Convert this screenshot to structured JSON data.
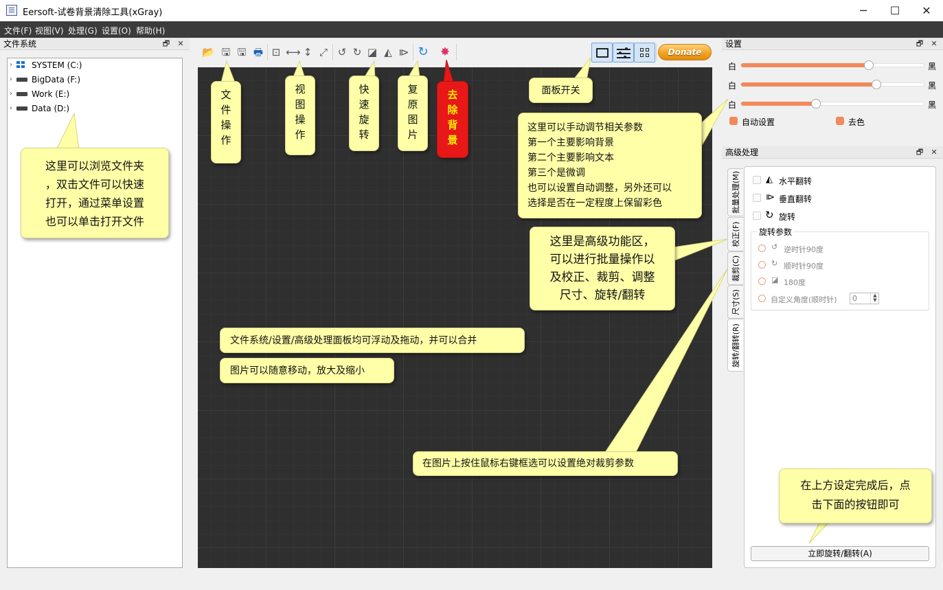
{
  "window": {
    "title": "Eersoft-试卷背景清除工具(xGray)",
    "minimize_glyph": "─",
    "maximize_glyph": "☐",
    "close_glyph": "✕"
  },
  "menu": [
    "文件(F)",
    "视图(V)",
    "处理(G)",
    "设置(O)",
    "帮助(H)"
  ],
  "file_panel": {
    "title": "文件系统",
    "drives": [
      {
        "label": "SYSTEM (C:)",
        "icon": "windows-drive-icon"
      },
      {
        "label": "BigData (F:)",
        "icon": "drive-icon"
      },
      {
        "label": "Work (E:)",
        "icon": "drive-icon"
      },
      {
        "label": "Data (D:)",
        "icon": "drive-icon"
      }
    ]
  },
  "toolbar": {
    "donate_label": "Donate",
    "icons": [
      "open-folder-icon",
      "save-icon",
      "save-as-icon",
      "print-icon",
      "fit-icon",
      "fit-width-icon",
      "fit-height-icon",
      "fullscreen-icon",
      "rotate-left-icon",
      "rotate-right-icon",
      "rotate-180-icon",
      "flip-horizontal-icon",
      "flip-vertical-icon",
      "restore-icon",
      "magic-wand-icon",
      "folder-panel-icon",
      "sliders-panel-icon",
      "grid-panel-icon"
    ]
  },
  "callouts": {
    "file_ops": "文件操作",
    "view_ops": "视图操作",
    "quick_rotate": "快速旋转",
    "restore_image": "复原图片",
    "remove_bg": "去除背景",
    "panel_switch": "面板开关",
    "browse_folder": [
      "这里可以浏览文件夹",
      "，双击文件可以快速",
      "打开，通过菜单设置",
      "也可以单击打开文件"
    ],
    "params": [
      "这里可以手动调节相关参数",
      "第一个主要影响背景",
      "第二个主要影响文本",
      "第三个是微调",
      "也可以设置自动调整，另外还可以",
      "选择是否在一定程度上保留彩色"
    ],
    "advanced": [
      "这里是高级功能区，",
      "可以进行批量操作以",
      "及校正、裁剪、调整",
      "尺寸、旋转/翻转"
    ],
    "float_panels": "文件系统/设置/高级处理面板均可浮动及拖动，并可以合并",
    "move_zoom": "图片可以随意移动，放大及缩小",
    "crop_hint": "在图片上按住鼠标右键框选可以设置绝对裁剪参数",
    "apply_hint": [
      "在上方设定完成后，点",
      "击下面的按钮即可"
    ]
  },
  "settings_panel": {
    "title": "设置",
    "left_label": "白",
    "right_label": "黑",
    "sliders": [
      0.7,
      0.74,
      0.41
    ],
    "auto_setting": "自动设置",
    "decolor": "去色"
  },
  "advanced_panel": {
    "title": "高级处理",
    "tabs": [
      "批量处理(M)",
      "校正(F)",
      "裁剪(C)",
      "尺寸(S)",
      "旋转/翻转(R)"
    ],
    "flip_horizontal": "水平翻转",
    "flip_vertical": "垂直翻转",
    "rotate": "旋转",
    "rotate_params": "旋转参数",
    "ccw90": "逆时针90度",
    "cw90": "顺时针90度",
    "r180": "180度",
    "custom": "自定义角度(顺时针)",
    "custom_value": "0",
    "apply_button": "立即旋转/翻转(A)"
  },
  "colors": {
    "accent_orange": "#f08a5a",
    "callout_yellow": "#ffffa8",
    "callout_red": "#e81818",
    "canvas_dark": "#2f2f2f"
  }
}
